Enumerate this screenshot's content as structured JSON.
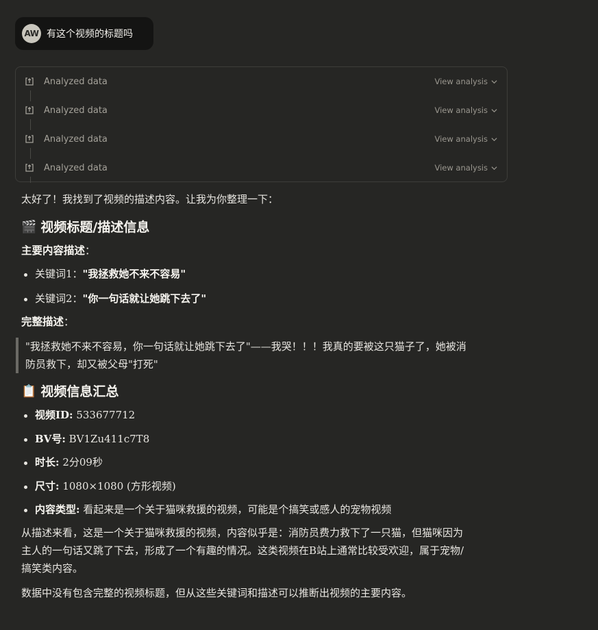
{
  "user_message": {
    "avatar_initials": "AW",
    "text": "有这个视频的标题吗"
  },
  "tool_calls": [
    {
      "label": "Analyzed data",
      "action": "View analysis"
    },
    {
      "label": "Analyzed data",
      "action": "View analysis"
    },
    {
      "label": "Analyzed data",
      "action": "View analysis"
    },
    {
      "label": "Analyzed data",
      "action": "View analysis"
    }
  ],
  "response": {
    "intro": "太好了！我找到了视频的描述内容。让我为你整理一下：",
    "section1": {
      "emoji": "🎬",
      "title": "视频标题/描述信息",
      "main_label": "主要内容描述",
      "main_colon": "：",
      "keywords": [
        {
          "label": "关键词1：",
          "value": "\"我拯救她不来不容易\""
        },
        {
          "label": "关键词2：",
          "value": "\"你一句话就让她跳下去了\""
        }
      ],
      "full_label": "完整描述",
      "full_colon": "：",
      "quote_line1": "\"我拯救她不来不容易，你一句话就让她跳下去了\"——我哭！！！我真的要被这只猫子了，她被消",
      "quote_line2": "防员救下，却又被父母\"打死\""
    },
    "section2": {
      "emoji": "📋",
      "title": "视频信息汇总",
      "items": [
        {
          "label": "视频ID:",
          "value": " 533677712"
        },
        {
          "label": "BV号:",
          "value": " BV1Zu411c7T8"
        },
        {
          "label": "时长:",
          "value": " 2分09秒"
        },
        {
          "label": "尺寸:",
          "value": " 1080×1080 (方形视频)"
        },
        {
          "label": "内容类型:",
          "value": " 看起来是一个关于猫咪救援的视频，可能是个搞笑或感人的宠物视频"
        }
      ]
    },
    "summary_line1": "从描述来看，这是一个关于猫咪救援的视频，内容似乎是：消防员费力救下了一只猫，但猫咪因为",
    "summary_line2": "主人的一句话又跳了下去，形成了一个有趣的情况。这类视频在B站上通常比较受欢迎，属于宠物/",
    "summary_line3": "搞笑类内容。",
    "closing": "数据中没有包含完整的视频标题，但从这些关键词和描述可以推断出视频的主要内容。"
  }
}
